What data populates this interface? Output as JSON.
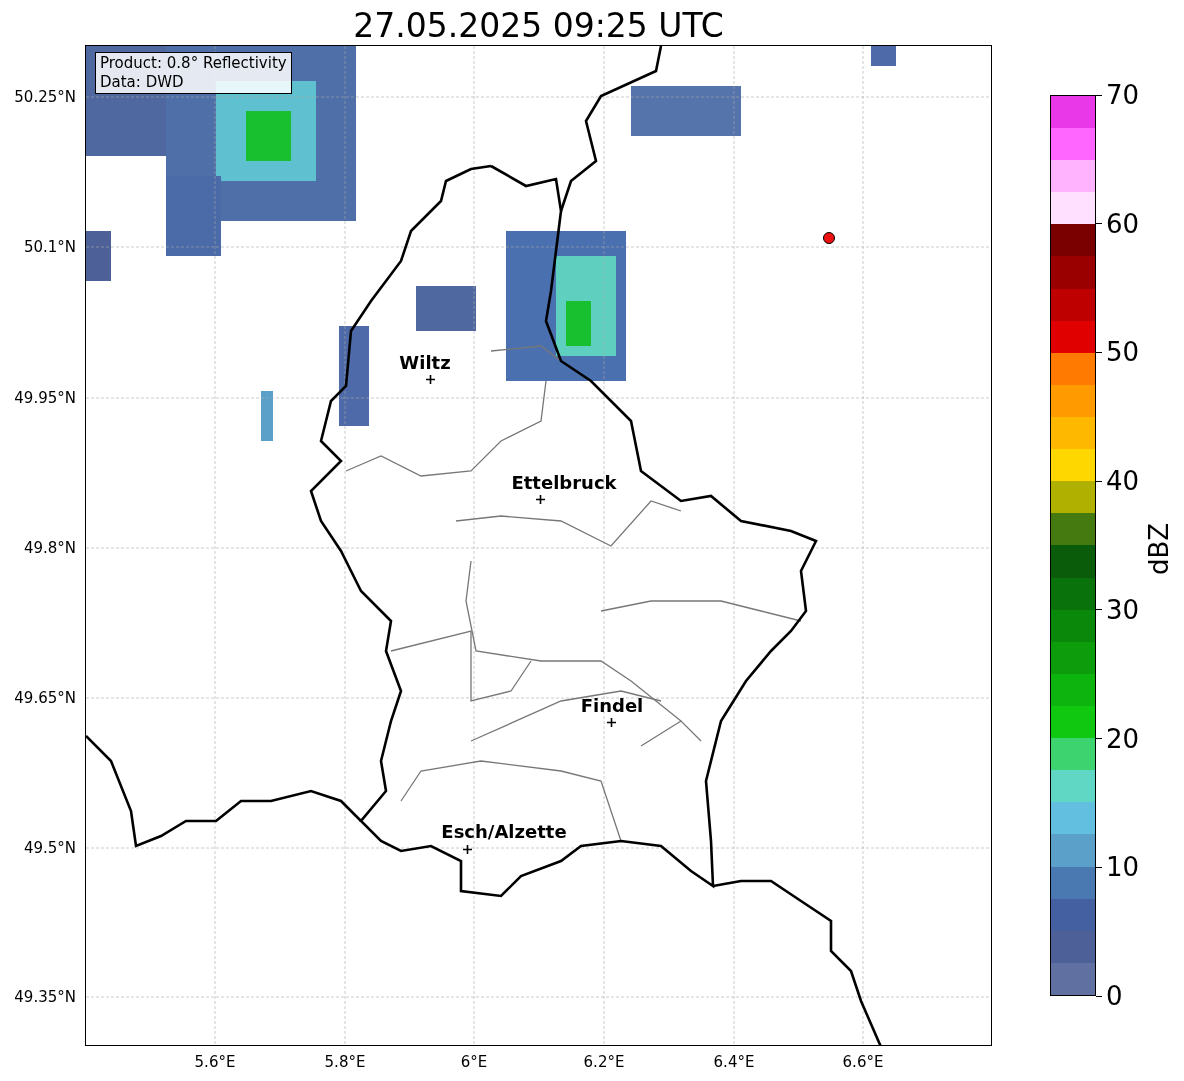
{
  "title": "27.05.2025 09:25 UTC",
  "info_box": [
    "Product: 0.8° Reflectivity",
    "Data: DWD"
  ],
  "lat_ticks": [
    "50.25°N",
    "50.1°N",
    "49.95°N",
    "49.8°N",
    "49.65°N",
    "49.5°N",
    "49.35°N"
  ],
  "lon_ticks": [
    "5.6°E",
    "5.8°E",
    "6°E",
    "6.2°E",
    "6.4°E",
    "6.6°E"
  ],
  "cities": [
    {
      "name": "Wiltz"
    },
    {
      "name": "Ettelbruck"
    },
    {
      "name": "Findel"
    },
    {
      "name": "Esch/Alzette"
    }
  ],
  "radar_site": {
    "color": "#ee1111"
  },
  "colorbar": {
    "label": "dBZ",
    "ticks": [
      "70",
      "60",
      "50",
      "40",
      "30",
      "20",
      "10",
      "0"
    ],
    "segments": [
      {
        "color": "#6070a0"
      },
      {
        "color": "#4e6098"
      },
      {
        "color": "#4460a0"
      },
      {
        "color": "#4a78b0"
      },
      {
        "color": "#5aa0c8"
      },
      {
        "color": "#63bfe0"
      },
      {
        "color": "#5fd7c4"
      },
      {
        "color": "#3dd36f"
      },
      {
        "color": "#10c810"
      },
      {
        "color": "#0db40d"
      },
      {
        "color": "#0c9c0c"
      },
      {
        "color": "#0a880a"
      },
      {
        "color": "#0a720a"
      },
      {
        "color": "#0a5c0a"
      },
      {
        "color": "#457a10"
      },
      {
        "color": "#b0b000"
      },
      {
        "color": "#ffd700"
      },
      {
        "color": "#ffb800"
      },
      {
        "color": "#ff9a00"
      },
      {
        "color": "#ff7a00"
      },
      {
        "color": "#e00000"
      },
      {
        "color": "#bf0000"
      },
      {
        "color": "#9b0000"
      },
      {
        "color": "#7a0000"
      },
      {
        "color": "#ffe0ff"
      },
      {
        "color": "#ffb3ff"
      },
      {
        "color": "#ff66ff"
      },
      {
        "color": "#e838e8"
      }
    ]
  }
}
